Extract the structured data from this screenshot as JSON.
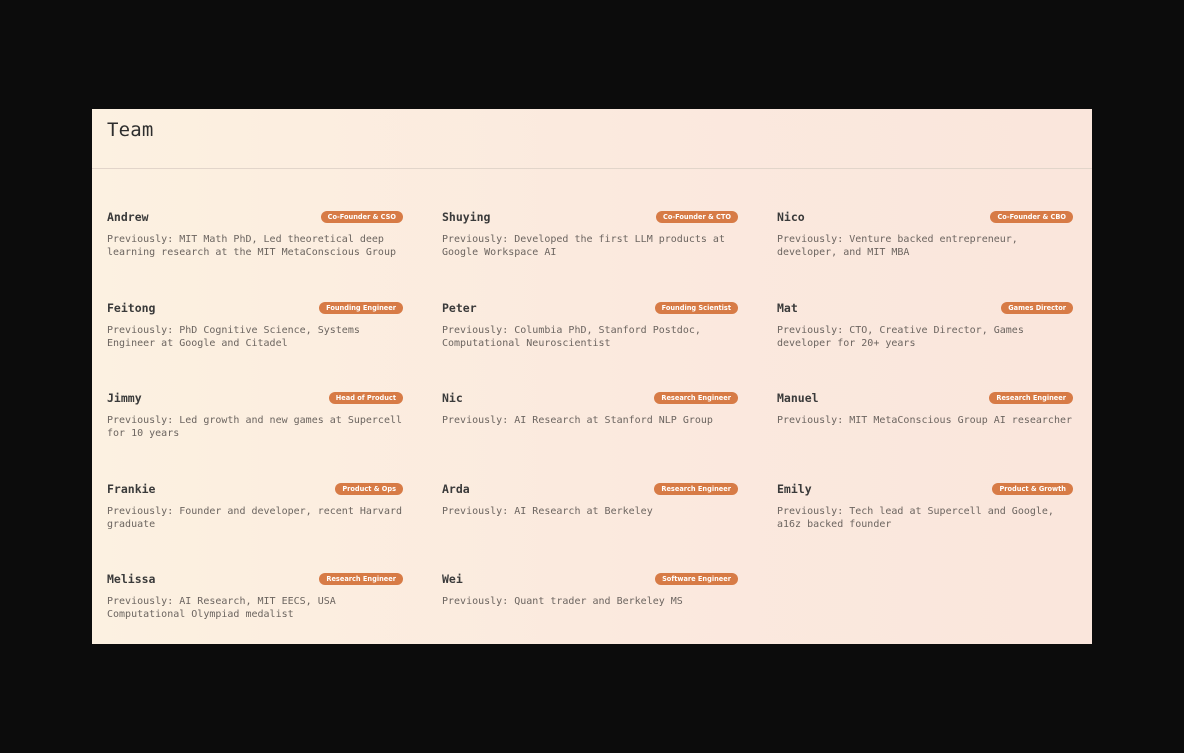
{
  "section": {
    "title": "Team"
  },
  "colors": {
    "badge": "#d77b46",
    "background": "#0c0c0c",
    "panel": "#fcf1e1"
  },
  "members": [
    {
      "name": "Andrew",
      "role": "Co-Founder & CSO",
      "bio": "Previously: MIT Math PhD, Led theoretical deep learning research at the MIT MetaConscious Group"
    },
    {
      "name": "Shuying",
      "role": "Co-Founder & CTO",
      "bio": "Previously: Developed the first LLM products at Google Workspace AI"
    },
    {
      "name": "Nico",
      "role": "Co-Founder & CBO",
      "bio": "Previously: Venture backed entrepreneur, developer, and MIT MBA"
    },
    {
      "name": "Feitong",
      "role": "Founding Engineer",
      "bio": "Previously: PhD Cognitive Science, Systems Engineer at Google and Citadel"
    },
    {
      "name": "Peter",
      "role": "Founding Scientist",
      "bio": "Previously: Columbia PhD, Stanford Postdoc, Computational Neuroscientist"
    },
    {
      "name": "Mat",
      "role": "Games Director",
      "bio": "Previously: CTO, Creative Director, Games developer for 20+ years"
    },
    {
      "name": "Jimmy",
      "role": "Head of Product",
      "bio": "Previously: Led growth and new games at Supercell for 10 years"
    },
    {
      "name": "Nic",
      "role": "Research Engineer",
      "bio": "Previously: AI Research at Stanford NLP Group"
    },
    {
      "name": "Manuel",
      "role": "Research Engineer",
      "bio": "Previously: MIT MetaConscious Group AI researcher"
    },
    {
      "name": "Frankie",
      "role": "Product & Ops",
      "bio": "Previously: Founder and developer, recent Harvard graduate"
    },
    {
      "name": "Arda",
      "role": "Research Engineer",
      "bio": "Previously: AI Research at Berkeley"
    },
    {
      "name": "Emily",
      "role": "Product & Growth",
      "bio": "Previously: Tech lead at Supercell and Google, a16z backed founder"
    },
    {
      "name": "Melissa",
      "role": "Research Engineer",
      "bio": "Previously: AI Research, MIT EECS, USA Computational Olympiad medalist"
    },
    {
      "name": "Wei",
      "role": "Software Engineer",
      "bio": "Previously: Quant trader and Berkeley MS"
    }
  ]
}
